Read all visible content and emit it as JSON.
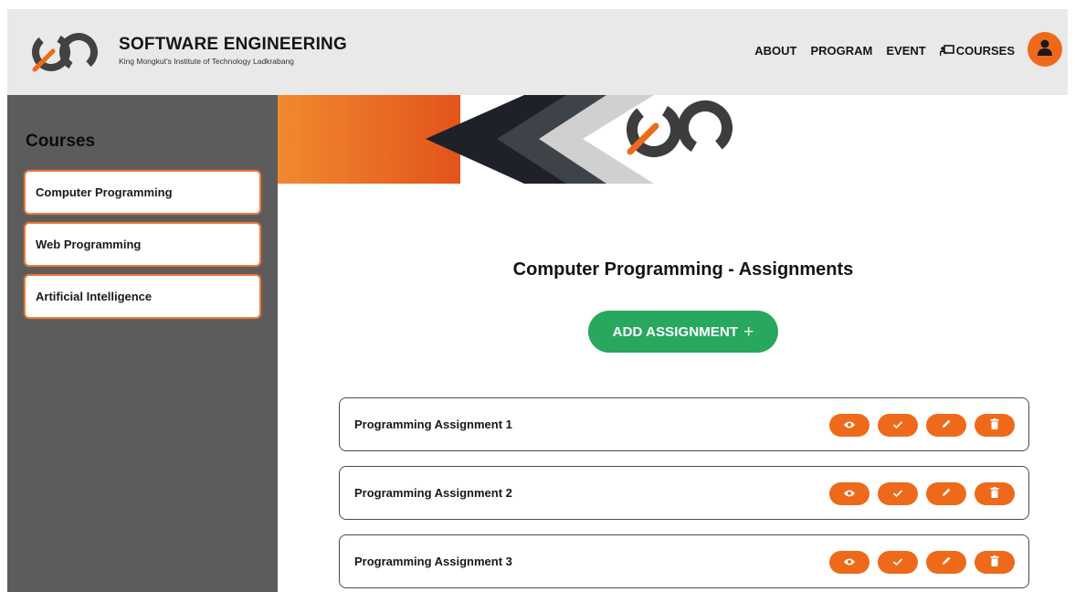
{
  "header": {
    "brand_title": "SOFTWARE ENGINEERING",
    "brand_subtitle": "King Mongkut's Institute of Technology Ladkrabang",
    "logo_icon": "se-logo-icon",
    "nav": [
      {
        "label": "ABOUT"
      },
      {
        "label": "PROGRAM"
      },
      {
        "label": "EVENT"
      },
      {
        "label": "COURSES",
        "icon": "courses-icon"
      }
    ],
    "avatar_icon": "user-icon"
  },
  "sidebar": {
    "title": "Courses",
    "items": [
      {
        "label": "Computer Programming"
      },
      {
        "label": "Web Programming"
      },
      {
        "label": "Artificial Intelligence"
      }
    ]
  },
  "main": {
    "title": "Computer Programming - Assignments",
    "add_button": {
      "label": "ADD ASSIGNMENT",
      "icon": "plus-icon"
    },
    "assignments": [
      {
        "name": "Programming Assignment 1"
      },
      {
        "name": "Programming Assignment 2"
      },
      {
        "name": "Programming Assignment 3"
      }
    ],
    "row_actions": [
      "view-icon",
      "check-icon",
      "edit-icon",
      "delete-icon"
    ]
  },
  "colors": {
    "accent": "#ee6a1a",
    "success": "#27a85d",
    "sidebar": "#5c5c5c",
    "header": "#e9e9e9"
  }
}
